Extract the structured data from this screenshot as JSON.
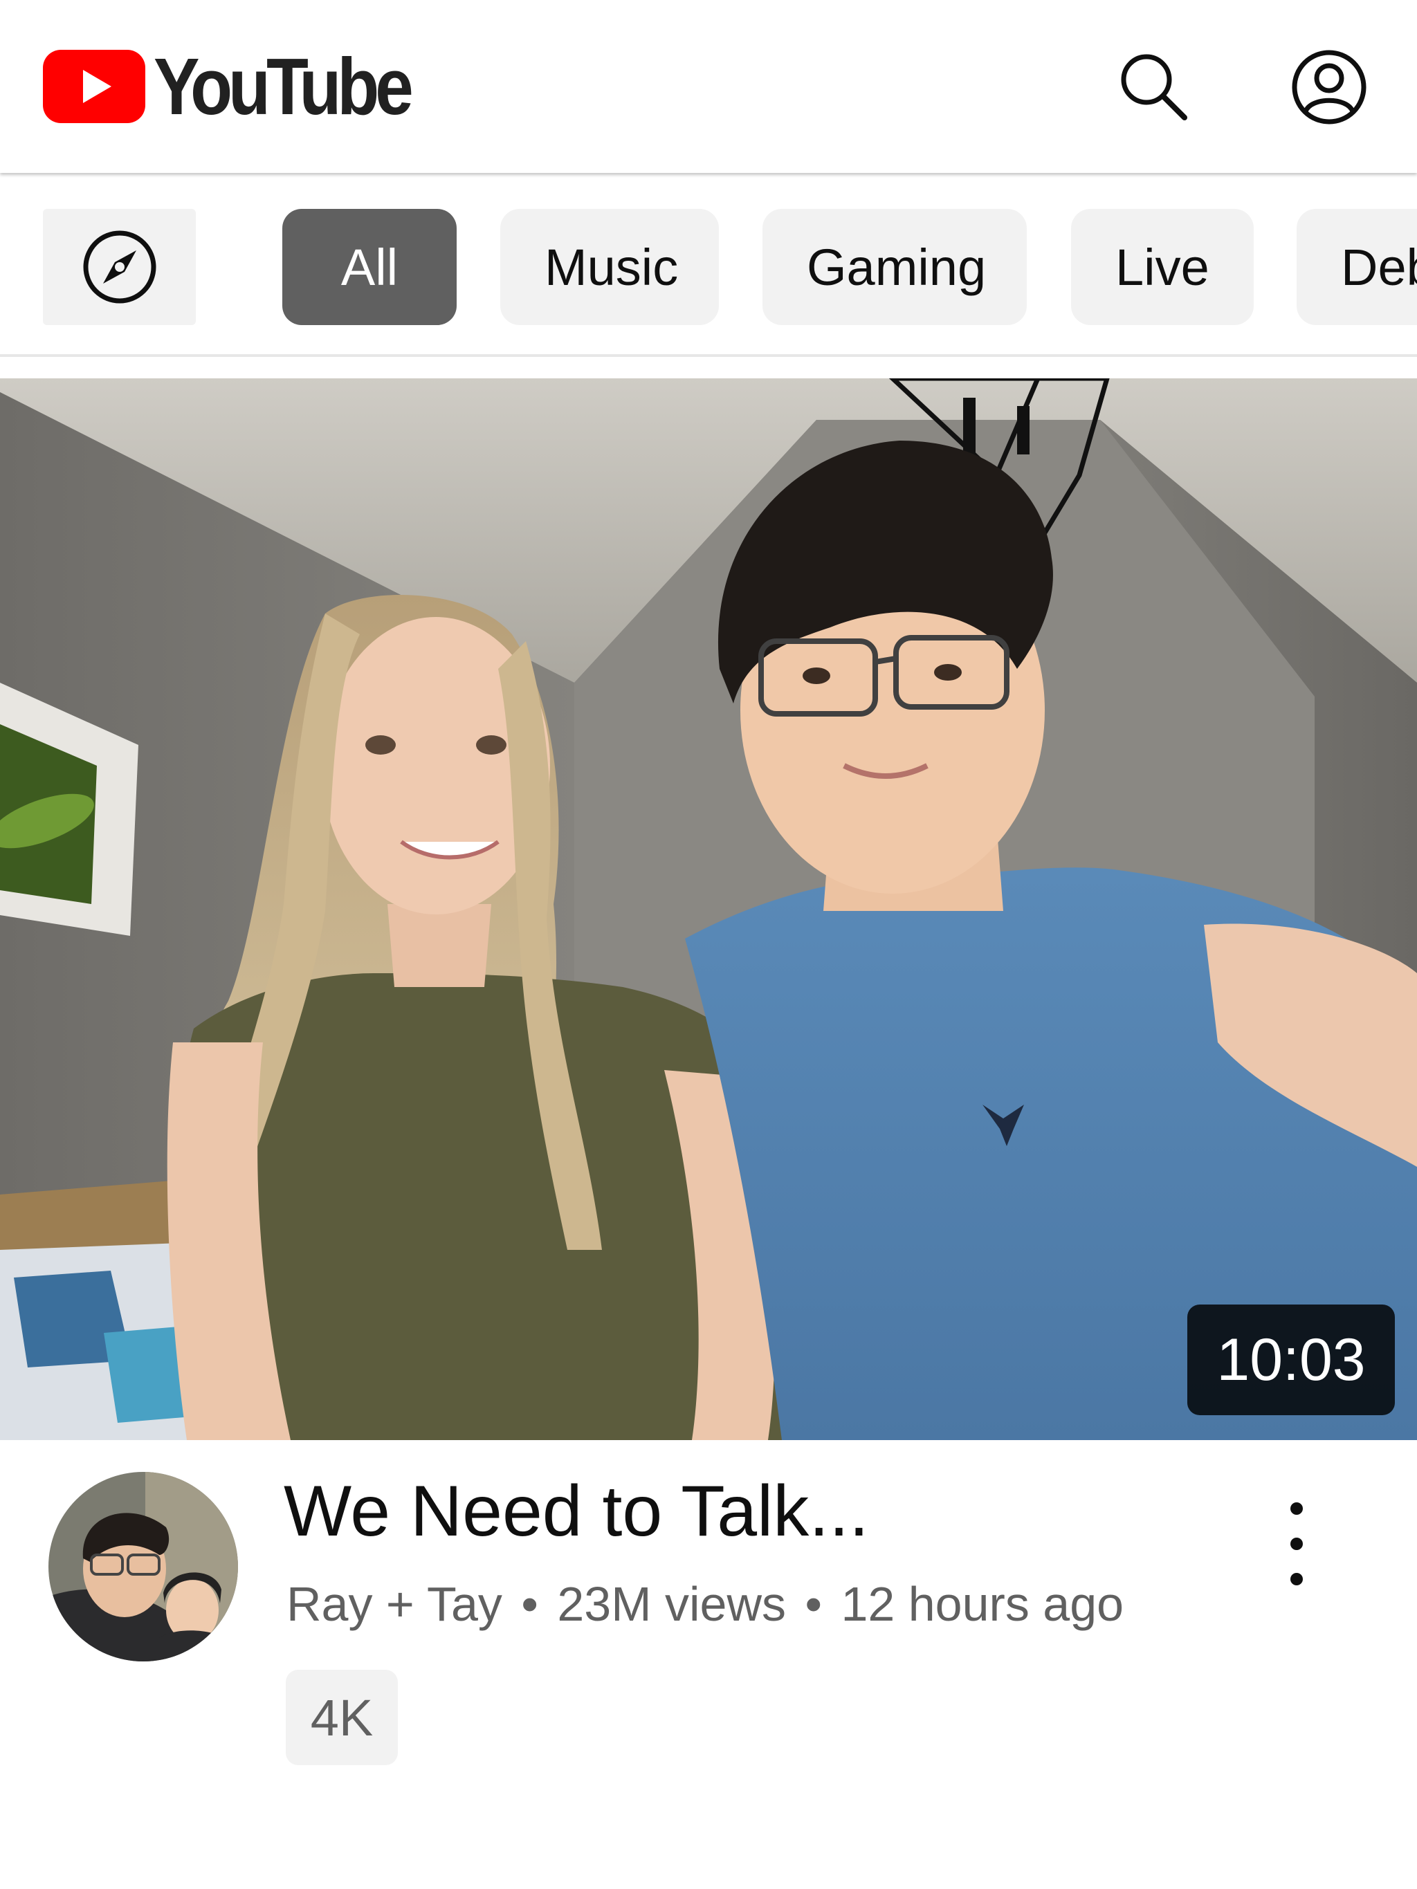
{
  "header": {
    "logo_text": "YouTube",
    "logo_color": "#ff0000",
    "search_icon": "search-icon",
    "account_icon": "account-icon"
  },
  "chips": {
    "explore_icon": "compass-icon",
    "items": [
      {
        "label": "All",
        "selected": true
      },
      {
        "label": "Music",
        "selected": false
      },
      {
        "label": "Gaming",
        "selected": false
      },
      {
        "label": "Live",
        "selected": false
      },
      {
        "label": "Deb",
        "selected": false
      }
    ]
  },
  "video": {
    "duration": "10:03",
    "title": "We Need to Talk...",
    "channel": "Ray + Tay",
    "separator": "•",
    "views": "23M views",
    "age": "12 hours ago",
    "badge": "4K",
    "more_icon": "more-vertical-icon"
  },
  "colors": {
    "chip_selected_bg": "#606060",
    "chip_bg": "#f2f2f2",
    "secondary_text": "#606060"
  }
}
